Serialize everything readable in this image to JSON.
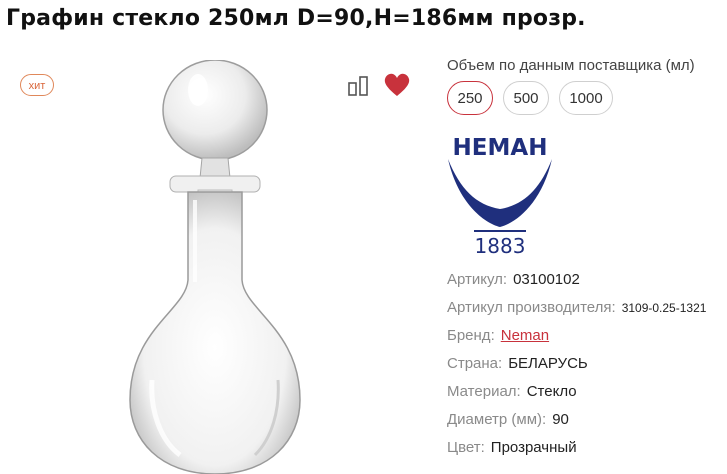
{
  "product": {
    "title": "Графин стекло 250мл D=90,H=186мм прозр.",
    "badge": "хит"
  },
  "icons": {
    "compare": "compare-icon",
    "favorite": "heart-icon",
    "favorite_color": "#c8323c"
  },
  "volume": {
    "label": "Объем по данным поставщика (мл)",
    "options": [
      "250",
      "500",
      "1000"
    ],
    "selected": "250"
  },
  "brand_logo": {
    "name": "НЕМАН",
    "year": "1883",
    "color": "#1f2f7d"
  },
  "specs": [
    {
      "key": "Артикул:",
      "value": "03100102"
    },
    {
      "key": "Артикул производителя:",
      "value": "3109-0.25-1321"
    },
    {
      "key": "Бренд:",
      "value": "Neman"
    },
    {
      "key": "Страна:",
      "value": "БЕЛАРУСЬ"
    },
    {
      "key": "Материал:",
      "value": "Стекло"
    },
    {
      "key": "Диаметр (мм):",
      "value": "90"
    },
    {
      "key": "Цвет:",
      "value": "Прозрачный"
    }
  ]
}
